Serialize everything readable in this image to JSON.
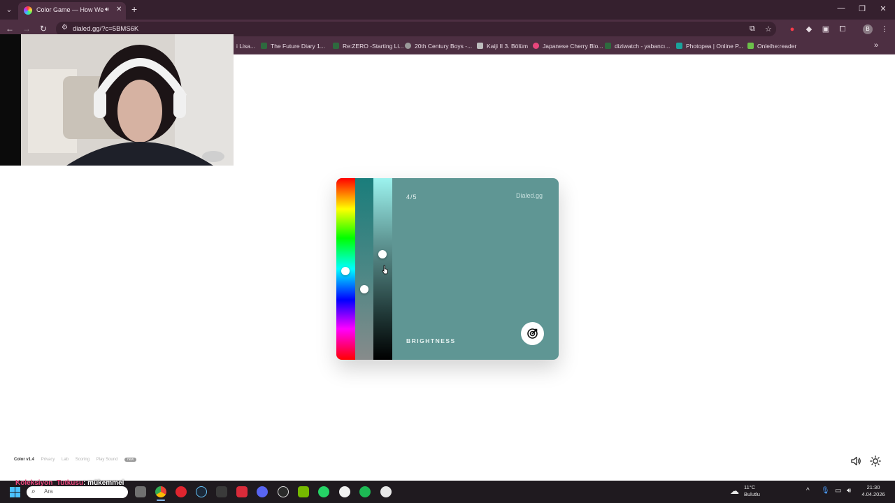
{
  "browser": {
    "tab": {
      "title": "Color Game — How Well C"
    },
    "url": "dialed.gg/?c=5BMS6K",
    "bookmarks": [
      "i Lisa...",
      "The Future Diary 1...",
      "Re:ZERO -Starting Li...",
      "20th Century Boys -...",
      "Kaiji II 3. Bölüm",
      "Japanese Cherry Blo...",
      "diziwatch - yabancı...",
      "Photopea | Online P...",
      "Onleihe:reader"
    ],
    "profile_initial": "B"
  },
  "game": {
    "round": "4/5",
    "brand": "Dialed.gg",
    "mode_label": "BRIGHTNESS",
    "current_color": "#5f9694",
    "sliders": {
      "hue": 0.51,
      "saturation": 0.61,
      "brightness": 0.42
    }
  },
  "footer": {
    "version": "Color v1.4",
    "links": [
      "Privacy",
      "Lab",
      "Scoring",
      "Play Sound"
    ],
    "badge": "new"
  },
  "chat": {
    "user": "Koleksiyon_Tutkusu",
    "message": ": mükemmel"
  },
  "taskbar": {
    "search_placeholder": "Ara",
    "weather_temp": "11°C",
    "weather_desc": "Bulutlu",
    "time": "21:30",
    "date": "4.04.2026"
  }
}
